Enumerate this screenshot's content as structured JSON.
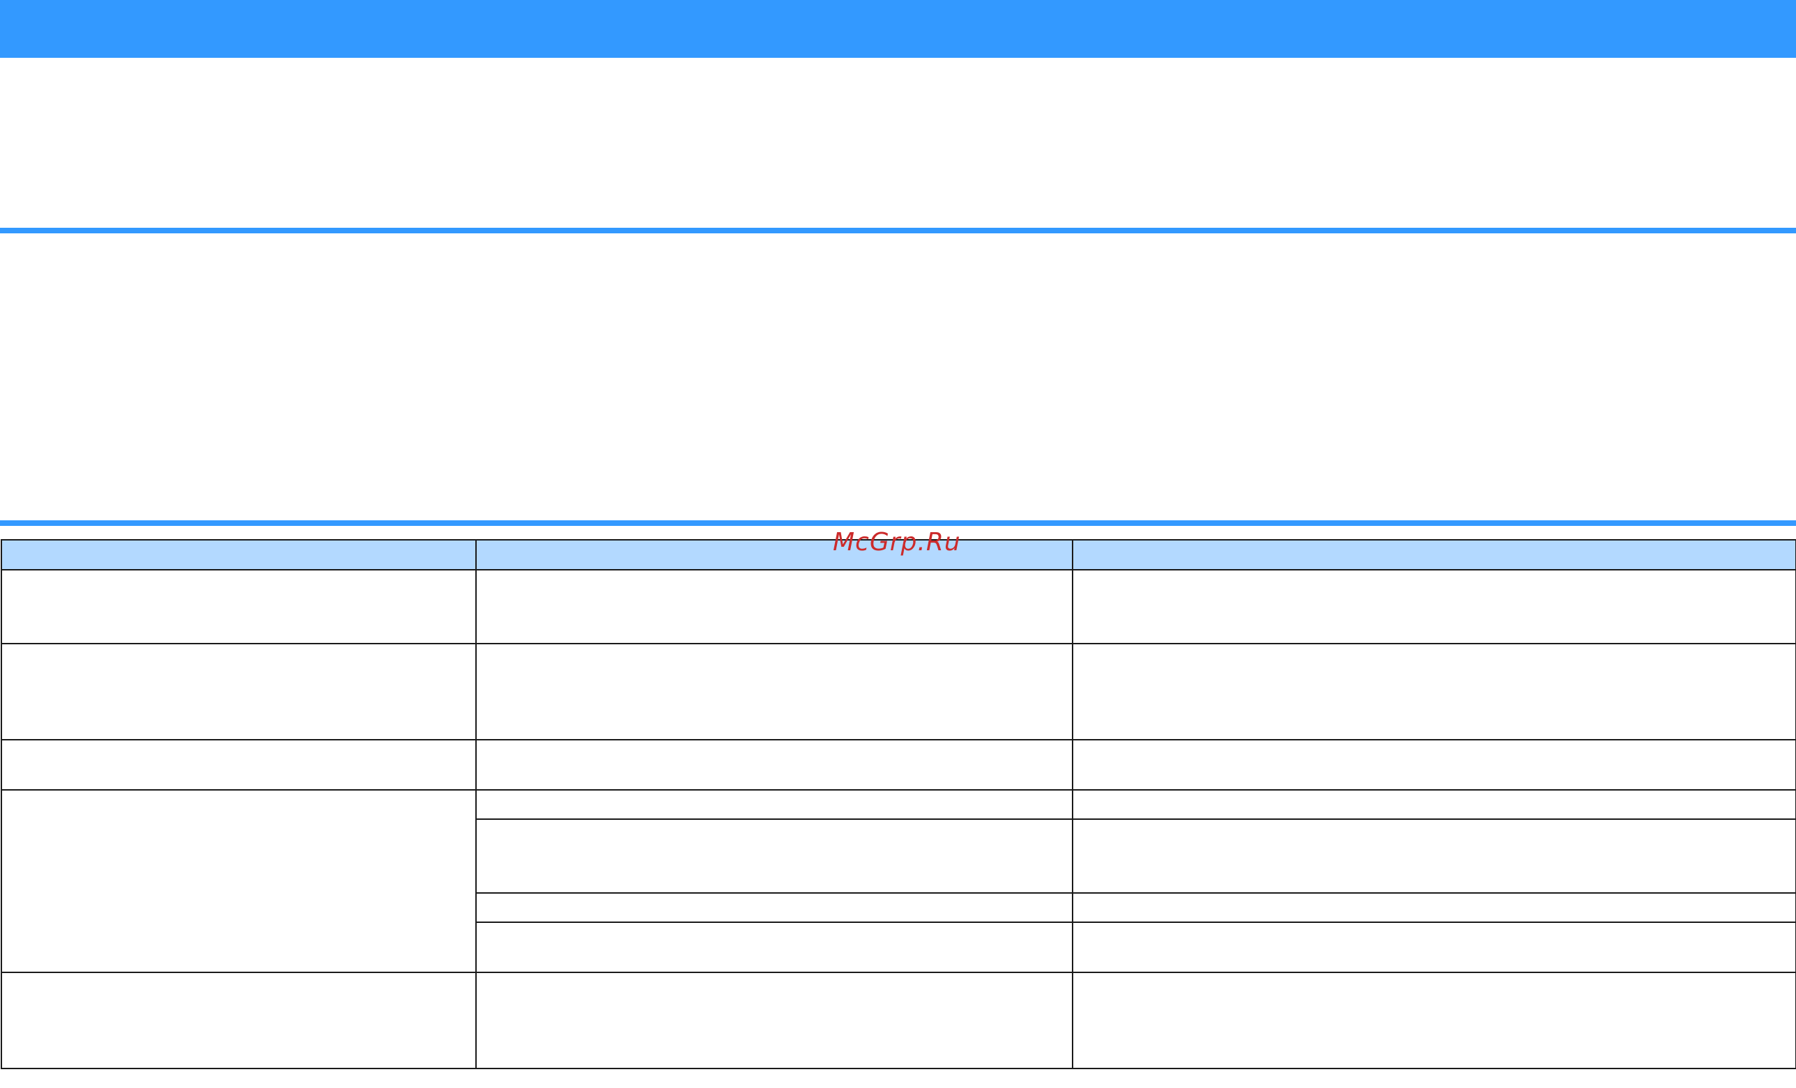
{
  "watermark": "McGrp.Ru",
  "colors": {
    "accent": "#3399ff",
    "table_header": "#b3d9ff",
    "watermark": "#cc2b2b"
  },
  "table": {
    "headers": [
      "",
      "",
      ""
    ],
    "rows": [
      {
        "cells": [
          "",
          "",
          ""
        ]
      },
      {
        "cells": [
          "",
          "",
          ""
        ]
      },
      {
        "cells": [
          "",
          "",
          ""
        ]
      },
      {
        "cells": [
          "",
          "",
          ""
        ]
      },
      {
        "cells": [
          "",
          ""
        ]
      },
      {
        "cells": [
          "",
          ""
        ]
      },
      {
        "cells": [
          "",
          ""
        ]
      },
      {
        "cells": [
          "",
          "",
          ""
        ]
      }
    ]
  }
}
